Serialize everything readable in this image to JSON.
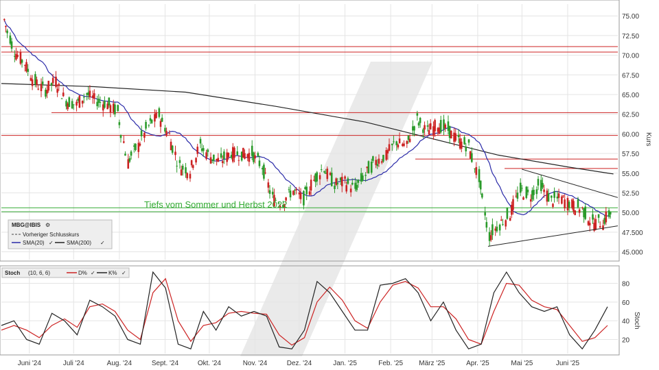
{
  "chart_data": [
    {
      "type": "candlestick",
      "symbol": "MBG@IBIS",
      "ylabel": "Kurs",
      "ylim": [
        44,
        76.5
      ],
      "y_ticks": [
        "45.000",
        "47.500",
        "50.00",
        "52.50",
        "55.00",
        "57.50",
        "60.00",
        "62.50",
        "65.00",
        "67.50",
        "70.00",
        "72.50",
        "75.00"
      ],
      "x_ticks": [
        "Juni '24",
        "Juli '24",
        "Aug. '24",
        "Sept. '24",
        "Okt. '24",
        "Nov. '24",
        "Dez. '24",
        "Jan. '25",
        "Feb. '25",
        "März '25",
        "Apr. '25",
        "Mai '25",
        "Juni '25"
      ],
      "legend": {
        "title": "MBG@IBIS",
        "items": [
          "Vorheriger Schlusskurs",
          "SMA(20)",
          "SMA(200)"
        ]
      },
      "annotation": "Tiefs vom Sommer und Herbst 2022",
      "horizontal_lines": [
        {
          "value": 71.1,
          "color": "#cc2222"
        },
        {
          "value": 70.4,
          "color": "#cc2222"
        },
        {
          "value": 62.7,
          "color": "#cc2222"
        },
        {
          "value": 59.8,
          "color": "#cc2222"
        },
        {
          "value": 56.8,
          "color": "#cc2222"
        },
        {
          "value": 55.6,
          "color": "#cc2222"
        },
        {
          "value": 50.6,
          "color": "#33aa33"
        },
        {
          "value": 50.1,
          "color": "#33aa33"
        }
      ],
      "trendlines": [
        {
          "from": [
            "Apr. '25",
            45.7
          ],
          "to": [
            "end",
            48.3
          ]
        },
        {
          "from": [
            "Apr. '25",
            55.5
          ],
          "to": [
            "end",
            51.9
          ]
        }
      ],
      "close_series": [
        {
          "x": "2024-05-15",
          "y": 74.5
        },
        {
          "x": "2024-05-22",
          "y": 70.6
        },
        {
          "x": "2024-05-29",
          "y": 69.0
        },
        {
          "x": "2024-06-05",
          "y": 66.6
        },
        {
          "x": "2024-06-12",
          "y": 65.5
        },
        {
          "x": "2024-06-19",
          "y": 66.8
        },
        {
          "x": "2024-06-26",
          "y": 64.2
        },
        {
          "x": "2024-07-03",
          "y": 63.7
        },
        {
          "x": "2024-07-10",
          "y": 65.1
        },
        {
          "x": "2024-07-17",
          "y": 64.2
        },
        {
          "x": "2024-07-24",
          "y": 63.8
        },
        {
          "x": "2024-07-31",
          "y": 62.8
        },
        {
          "x": "2024-08-07",
          "y": 56.4
        },
        {
          "x": "2024-08-14",
          "y": 58.5
        },
        {
          "x": "2024-08-21",
          "y": 61.0
        },
        {
          "x": "2024-08-28",
          "y": 62.4
        },
        {
          "x": "2024-09-04",
          "y": 59.8
        },
        {
          "x": "2024-09-11",
          "y": 55.9
        },
        {
          "x": "2024-09-18",
          "y": 55.3
        },
        {
          "x": "2024-09-25",
          "y": 58.5
        },
        {
          "x": "2024-10-02",
          "y": 57.1
        },
        {
          "x": "2024-10-09",
          "y": 56.5
        },
        {
          "x": "2024-10-16",
          "y": 57.6
        },
        {
          "x": "2024-10-23",
          "y": 57.4
        },
        {
          "x": "2024-10-30",
          "y": 57.5
        },
        {
          "x": "2024-11-06",
          "y": 55.9
        },
        {
          "x": "2024-11-13",
          "y": 51.9
        },
        {
          "x": "2024-11-20",
          "y": 51.3
        },
        {
          "x": "2024-11-27",
          "y": 52.8
        },
        {
          "x": "2024-12-04",
          "y": 51.7
        },
        {
          "x": "2024-12-11",
          "y": 54.1
        },
        {
          "x": "2024-12-18",
          "y": 55.7
        },
        {
          "x": "2024-12-25",
          "y": 53.6
        },
        {
          "x": "2025-01-01",
          "y": 53.9
        },
        {
          "x": "2025-01-08",
          "y": 53.0
        },
        {
          "x": "2025-01-15",
          "y": 54.8
        },
        {
          "x": "2025-01-22",
          "y": 56.5
        },
        {
          "x": "2025-01-29",
          "y": 57.2
        },
        {
          "x": "2025-02-05",
          "y": 59.0
        },
        {
          "x": "2025-02-12",
          "y": 58.4
        },
        {
          "x": "2025-02-19",
          "y": 61.8
        },
        {
          "x": "2025-02-26",
          "y": 60.3
        },
        {
          "x": "2025-03-05",
          "y": 61.2
        },
        {
          "x": "2025-03-12",
          "y": 60.5
        },
        {
          "x": "2025-03-19",
          "y": 59.2
        },
        {
          "x": "2025-03-26",
          "y": 58.4
        },
        {
          "x": "2025-04-02",
          "y": 54.5
        },
        {
          "x": "2025-04-09",
          "y": 47.0
        },
        {
          "x": "2025-04-16",
          "y": 48.5
        },
        {
          "x": "2025-04-23",
          "y": 49.8
        },
        {
          "x": "2025-04-30",
          "y": 52.8
        },
        {
          "x": "2025-05-07",
          "y": 52.2
        },
        {
          "x": "2025-05-14",
          "y": 53.5
        },
        {
          "x": "2025-05-21",
          "y": 51.5
        },
        {
          "x": "2025-05-28",
          "y": 51.8
        },
        {
          "x": "2025-06-04",
          "y": 51.0
        },
        {
          "x": "2025-06-11",
          "y": 50.4
        },
        {
          "x": "2025-06-18",
          "y": 48.7
        },
        {
          "x": "2025-06-25",
          "y": 48.8
        },
        {
          "x": "2025-07-02",
          "y": 50.4
        }
      ],
      "series": [
        {
          "name": "SMA(20)",
          "color": "#2a2aa8"
        },
        {
          "name": "SMA(200)",
          "color": "#222222"
        }
      ]
    },
    {
      "type": "line",
      "title": "Stoch",
      "params": "(10, 6, 6)",
      "ylabel": "Stoch",
      "ylim": [
        5,
        95
      ],
      "y_ticks": [
        "20",
        "40",
        "60",
        "80"
      ],
      "series": [
        {
          "name": "D%",
          "color": "#cc2222"
        },
        {
          "name": "K%",
          "color": "#222222"
        }
      ],
      "k_values": [
        35,
        40,
        20,
        15,
        48,
        40,
        25,
        62,
        55,
        45,
        20,
        15,
        92,
        75,
        15,
        10,
        50,
        30,
        55,
        45,
        50,
        45,
        12,
        10,
        30,
        82,
        70,
        50,
        30,
        30,
        78,
        80,
        85,
        70,
        40,
        60,
        30,
        10,
        15,
        70,
        92,
        70,
        55,
        50,
        55,
        25,
        10,
        30,
        55
      ],
      "d_values": [
        30,
        35,
        30,
        22,
        35,
        42,
        33,
        55,
        58,
        50,
        30,
        20,
        70,
        85,
        40,
        18,
        35,
        38,
        48,
        50,
        48,
        47,
        25,
        14,
        22,
        60,
        76,
        62,
        40,
        32,
        60,
        78,
        82,
        75,
        55,
        55,
        42,
        20,
        15,
        50,
        80,
        78,
        62,
        55,
        52,
        35,
        18,
        22,
        35
      ]
    }
  ]
}
